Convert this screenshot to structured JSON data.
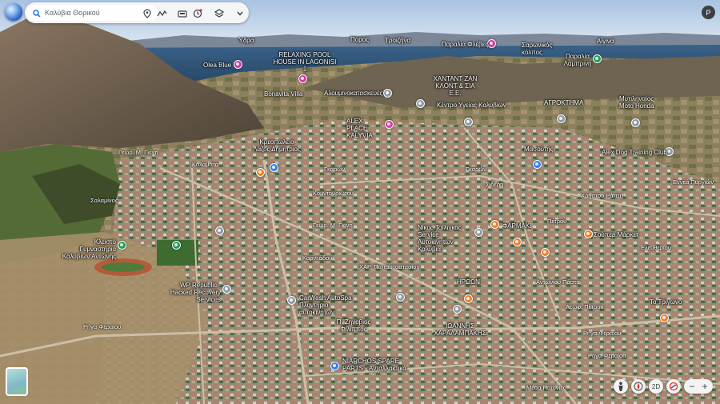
{
  "search": {
    "placeholder": "Καλύβια Θορικού"
  },
  "toolbar_icons": [
    "search-icon",
    "place-pin-icon",
    "route-icon",
    "camera-icon",
    "history-icon",
    "layers-icon",
    "chevron-down-icon"
  ],
  "account": {
    "initial": "P"
  },
  "controls": {
    "view_2d": "2D"
  },
  "colors": {
    "pin_gray": "#8e9aa3",
    "pin_pink": "#d63aa6",
    "pin_orange": "#f07d2a",
    "pin_green": "#1f9d55",
    "pin_blue": "#2f7ef0",
    "sea": "#2e5478",
    "sky": "#c9d8ea"
  },
  "places": [
    {
      "name": "Ύδρα"
    },
    {
      "name": "Πόρος"
    },
    {
      "name": "Τροιζήνα"
    },
    {
      "name": "Παραλία Φλέβες"
    },
    {
      "name": "Σαρωνικός κόλπος"
    },
    {
      "name": "Αίγινα"
    },
    {
      "name": "Olea Blue"
    },
    {
      "name": "RELAXING POOL HOUSE IN LAGONISI 1"
    },
    {
      "name": "ΧΑΝΤΑΝΤ ΖΑΝ ΚΛΟΝΤ & ΣΙΑ Ε.Ε."
    },
    {
      "name": "Παραλία Λαμπρινή"
    },
    {
      "name": "Bonavita Villa"
    },
    {
      "name": "Αλουμινοκατασκευές"
    },
    {
      "name": "Κέντρο Υγείας Καλυβίων"
    },
    {
      "name": "ΑΓΡΟΚΤΗΜΑ"
    },
    {
      "name": "Μυτιληναίος Moto Honda"
    },
    {
      "name": "ALEX PLACE KALYVIA"
    },
    {
      "name": "Κρεοπωλείο Λάζος Δημήτριος"
    },
    {
      "name": "Μασούτης"
    },
    {
      "name": "Alex Dog Training Club"
    },
    {
      "name": "Κλειστό Γυμναστήριο Καλυβίων Αντώνης"
    },
    {
      "name": "Νίκος Τσίλιγκας Service Αυτοκινήτων Καλύβια"
    },
    {
      "name": "ΦΑΡΜΑΚΕΙΟ"
    },
    {
      "name": "Σούπερ Μάρκετ"
    },
    {
      "name": "WP Republic - Hacked Recovery Services"
    },
    {
      "name": "CarWash AutoSpa Πλυντήριο αυτοκινήτων"
    },
    {
      "name": "ΗΡΩΩΝ"
    },
    {
      "name": "Το Τρίγωνο"
    },
    {
      "name": "ΙΩΑΝΝΗΣ ΧΑΡΑΛΑΜΠΑΚΗΣ"
    },
    {
      "name": "Π. Ζηνοβιος Φίλιππος"
    },
    {
      "name": "NIARCHOS SPARE PARTS - Ανταλλακτικά"
    }
  ],
  "roads": [
    {
      "name": "Γεωρ. Μ. Γκίνη"
    },
    {
      "name": "Γκαρών"
    },
    {
      "name": "Γκαρών"
    },
    {
      "name": "Σιδερή"
    },
    {
      "name": "Χρήστου Ράπτη"
    },
    {
      "name": "Εννεά Πυργιών"
    },
    {
      "name": "Πέτρου"
    },
    {
      "name": "Καρνεάδου"
    },
    {
      "name": "ΧΑΡ. Παπασταστασίου"
    },
    {
      "name": "Αντωνίου Πάστα"
    },
    {
      "name": "Λεωφ. Πέτρου"
    },
    {
      "name": "Ρήγα Φεραίου"
    },
    {
      "name": "Ρήγα Φεραίου"
    },
    {
      "name": "Ρήγα Φεραίου"
    },
    {
      "name": "Μέσα Γειτονιές"
    },
    {
      "name": "Γεωρ. Μ. Γκίνη"
    },
    {
      "name": "Κουντουριώτου"
    },
    {
      "name": "Σαλαμίνος"
    },
    {
      "name": "Ελευθερίου"
    },
    {
      "name": "Καλαμάτα"
    }
  ]
}
